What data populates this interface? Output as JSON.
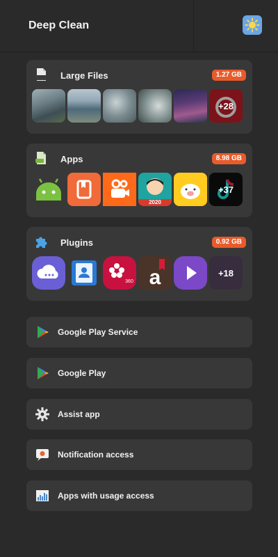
{
  "header": {
    "title": "Deep Clean",
    "settings_icon": "gear-sun-icon"
  },
  "sections": {
    "large_files": {
      "label": "Large Files",
      "size": "1.27 GB",
      "more": "+28",
      "icon": "file-icon"
    },
    "apps": {
      "label": "Apps",
      "size": "8.98 GB",
      "more": "+37",
      "icon": "apk-file-icon",
      "app_badge_text": "2020"
    },
    "plugins": {
      "label": "Plugins",
      "size": "0.92 GB",
      "more": "+18",
      "icon": "puzzle-icon"
    }
  },
  "rows": [
    {
      "label": "Google Play Service",
      "icon": "play-store-icon"
    },
    {
      "label": "Google Play",
      "icon": "play-store-icon"
    },
    {
      "label": "Assist app",
      "icon": "gear-icon"
    },
    {
      "label": "Notification access",
      "icon": "notification-icon"
    },
    {
      "label": "Apps with usage access",
      "icon": "usage-chart-icon"
    }
  ],
  "colors": {
    "badge": "#e85b2b",
    "card": "#383838",
    "background": "#2a2a2a"
  }
}
